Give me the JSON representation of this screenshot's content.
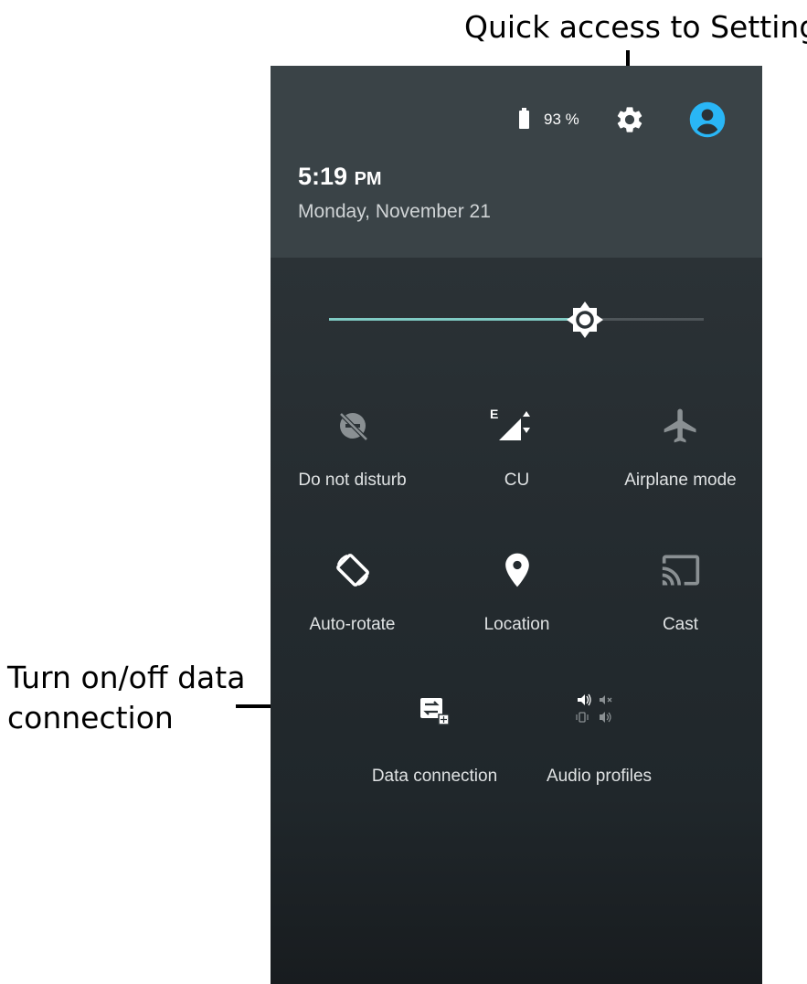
{
  "annotations": {
    "settings_callout": "Quick access to Setting",
    "data_callout_line1": "Turn on/off data",
    "data_callout_line2": "connection"
  },
  "status": {
    "battery_text": "93 %",
    "battery_icon": "battery-icon",
    "settings_icon": "gear-icon",
    "account_icon": "account-icon"
  },
  "clock": {
    "time": "5:19",
    "ampm": "PM",
    "date": "Monday, November 21"
  },
  "brightness": {
    "level": 0.69,
    "icon": "brightness-icon",
    "accent_color": "#80cbc4"
  },
  "tiles": [
    {
      "label": "Do not disturb",
      "icon": "do-not-disturb-icon",
      "enabled": false
    },
    {
      "label": "CU",
      "icon": "cell-signal-icon",
      "network_type": "E",
      "enabled": true
    },
    {
      "label": "Airplane mode",
      "icon": "airplane-icon",
      "enabled": false
    },
    {
      "label": "Auto-rotate",
      "icon": "auto-rotate-icon",
      "enabled": true
    },
    {
      "label": "Location",
      "icon": "location-pin-icon",
      "enabled": true
    },
    {
      "label": "Cast",
      "icon": "cast-icon",
      "enabled": false
    },
    {
      "label": "Data connection",
      "icon": "data-connection-icon",
      "enabled": true
    },
    {
      "label": "Audio profiles",
      "icon": "audio-profiles-icon",
      "enabled": true
    }
  ]
}
